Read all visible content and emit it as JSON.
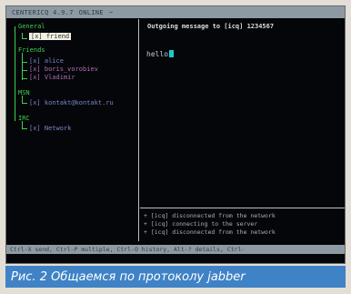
{
  "menubar": {
    "items": [
      "CENTERICQ 4.9.7",
      "ONLINE",
      "~",
      "",
      "",
      ""
    ]
  },
  "tree": {
    "groups": [
      {
        "label": "General",
        "contacts": [
          {
            "label": "[x] friend",
            "state": "selected"
          }
        ]
      },
      {
        "label": "Friends",
        "contacts": [
          {
            "label": "[x] alice",
            "state": "online"
          },
          {
            "label": "[x] boris_vorobiev",
            "state": "away"
          },
          {
            "label": "[x] Vladimir",
            "state": "away"
          }
        ]
      },
      {
        "label": "MSN",
        "contacts": [
          {
            "label": "[x] kontakt@kontakt.ru",
            "state": "online"
          }
        ]
      },
      {
        "label": "IRC",
        "contacts": [
          {
            "label": "[x] Network",
            "state": "online"
          }
        ]
      }
    ]
  },
  "chat": {
    "title": "Outgoing message to [icq] 1234567",
    "input_text": "hello"
  },
  "log": {
    "lines": [
      "+ [icq] disconnected from the network",
      "+ [icq] connecting to the server",
      "+ [icq] disconnected from the network"
    ]
  },
  "statusbar": {
    "text": "Ctrl-X send, Ctrl-P multiple, Ctrl-O history, Alt-? details, Ctrl-"
  },
  "caption": {
    "text": "Рис. 2 Общаемся по протоколу jabber"
  },
  "colors": {
    "group": "#3ad24a",
    "online": "#7a86c8",
    "away": "#b06eb6",
    "caption_bg": "#3f82c6",
    "cursor": "#1ec8d0"
  }
}
